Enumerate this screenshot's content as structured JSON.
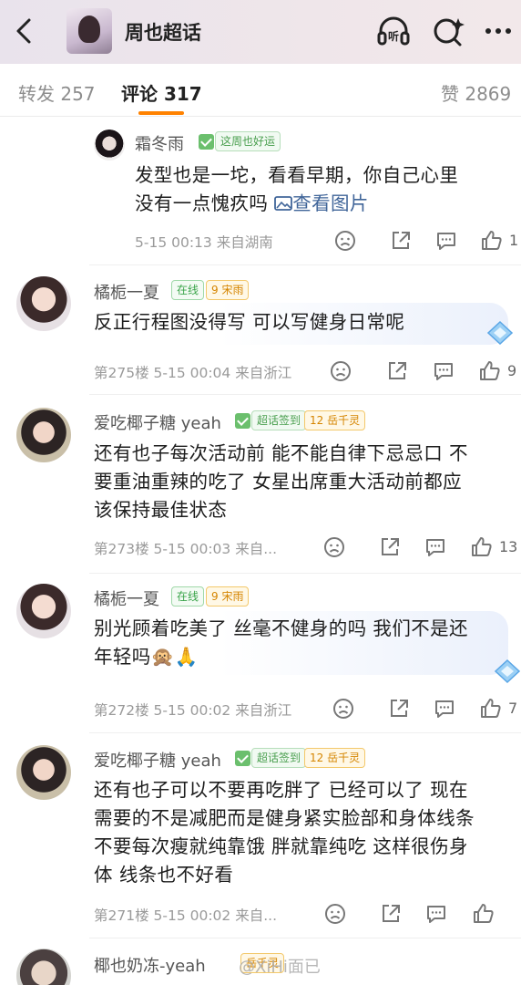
{
  "header": {
    "title": "周也超话",
    "listen_icon": "headphones-listen-icon",
    "search_icon": "ai-search-icon",
    "more_icon": "more-icon",
    "listen_label": "听"
  },
  "tabs": {
    "repost": {
      "label": "转发",
      "count": "257"
    },
    "comment": {
      "label": "评论",
      "count": "317"
    },
    "like": {
      "label": "赞",
      "count": "2869"
    }
  },
  "comments": [
    {
      "name": "霜冬雨",
      "badge": "这周也好运",
      "text_line1": "发型也是一坨，看看早期，你自己心里",
      "text_line2": "没有一点愧疚吗 ",
      "link": "查看图片",
      "meta": "5-15 00:13  来自湖南",
      "likes": "1"
    },
    {
      "name": "橘栀一夏",
      "online": "在线",
      "level": "9",
      "level_label": "宋雨",
      "text_line1": "反正行程图没得写 可以写健身日常呢",
      "meta": "第275楼  5-15 00:04  来自浙江",
      "likes": "9"
    },
    {
      "name": "爱吃椰子糖 yeah",
      "badge": "超话签到",
      "level": "12",
      "level_label": "岳千灵",
      "text_line1": "还有也子每次活动前 能不能自律下忌忌口 不",
      "text_line2": "要重油重辣的吃了 女星出席重大活动前都应",
      "text_line3": "该保持最佳状态",
      "meta": "第273楼  5-15 00:03  来自...",
      "likes": "13"
    },
    {
      "name": "橘栀一夏",
      "online": "在线",
      "level": "9",
      "level_label": "宋雨",
      "text_line1": "别光顾着吃美了 丝毫不健身的吗 我们不是还",
      "text_line2": "年轻吗🙊🙏",
      "meta": "第272楼  5-15 00:02  来自浙江",
      "likes": "7"
    },
    {
      "name": "爱吃椰子糖 yeah",
      "badge": "超话签到",
      "level": "12",
      "level_label": "岳千灵",
      "text_line1": "还有也子可以不要再吃胖了 已经可以了 现在",
      "text_line2": "需要的不是减肥而是健身紧实脸部和身体线条",
      "text_line3": "不要每次瘦就纯靠饿 胖就靠纯吃 这样很伤身",
      "text_line4": "体 线条也不好看",
      "meta": "第271楼  5-15 00:02  来自...",
      "likes": ""
    },
    {
      "name": "椰也奶冻-yeah",
      "level_label": "岳千灵"
    }
  ],
  "watermark": "@XiHi面已",
  "colors": {
    "accent": "#ff8200",
    "link": "#406599"
  }
}
